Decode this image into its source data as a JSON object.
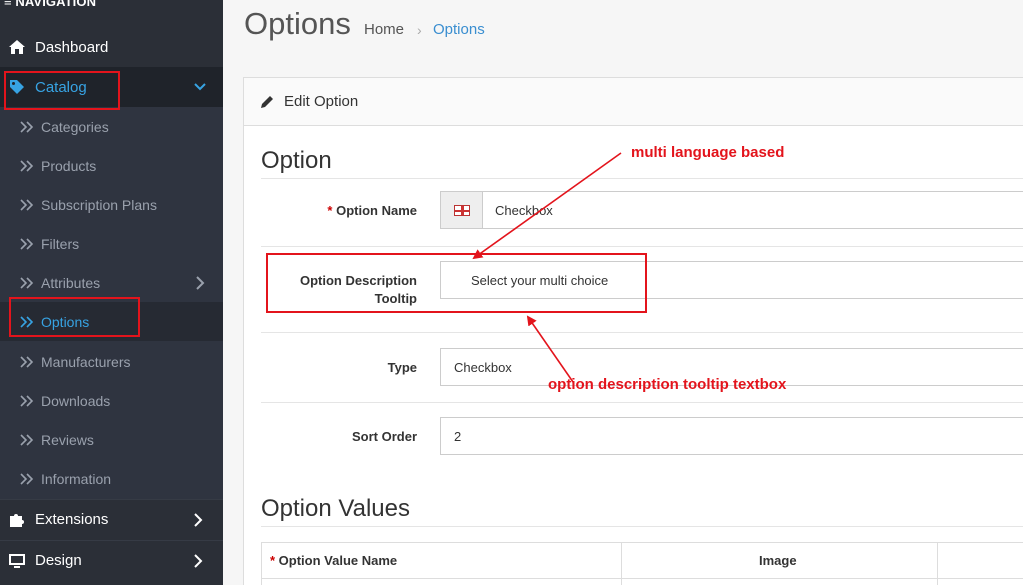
{
  "sidebar": {
    "header": "NAVIGATION",
    "dashboard": "Dashboard",
    "catalog": "Catalog",
    "submenu": [
      "Categories",
      "Products",
      "Subscription Plans",
      "Filters",
      "Attributes",
      "Options",
      "Manufacturers",
      "Downloads",
      "Reviews",
      "Information"
    ],
    "active_submenu": "Options",
    "extensions": "Extensions",
    "design": "Design"
  },
  "header": {
    "title": "Options",
    "breadcrumb": [
      "Home",
      "Options"
    ]
  },
  "panel": {
    "heading": "Edit Option",
    "section_title": "Option",
    "fields": {
      "option_name_label": "Option Name",
      "option_name_value": "Checkbox",
      "tooltip_label_line1": "Option Description",
      "tooltip_label_line2": "Tooltip",
      "tooltip_value": "Select your multi choice",
      "type_label": "Type",
      "type_value": "Checkbox",
      "sort_order_label": "Sort Order",
      "sort_order_value": "2"
    },
    "values_title": "Option Values",
    "table_headers": [
      "Option Value Name",
      "Image"
    ]
  },
  "annotations": {
    "multi_language": "multi language based",
    "tooltip_textbox": "option description tooltip textbox"
  },
  "colors": {
    "sidebar_bg": "#2b2f37",
    "accent": "#37a3e3",
    "annotation_red": "#e3141c"
  }
}
